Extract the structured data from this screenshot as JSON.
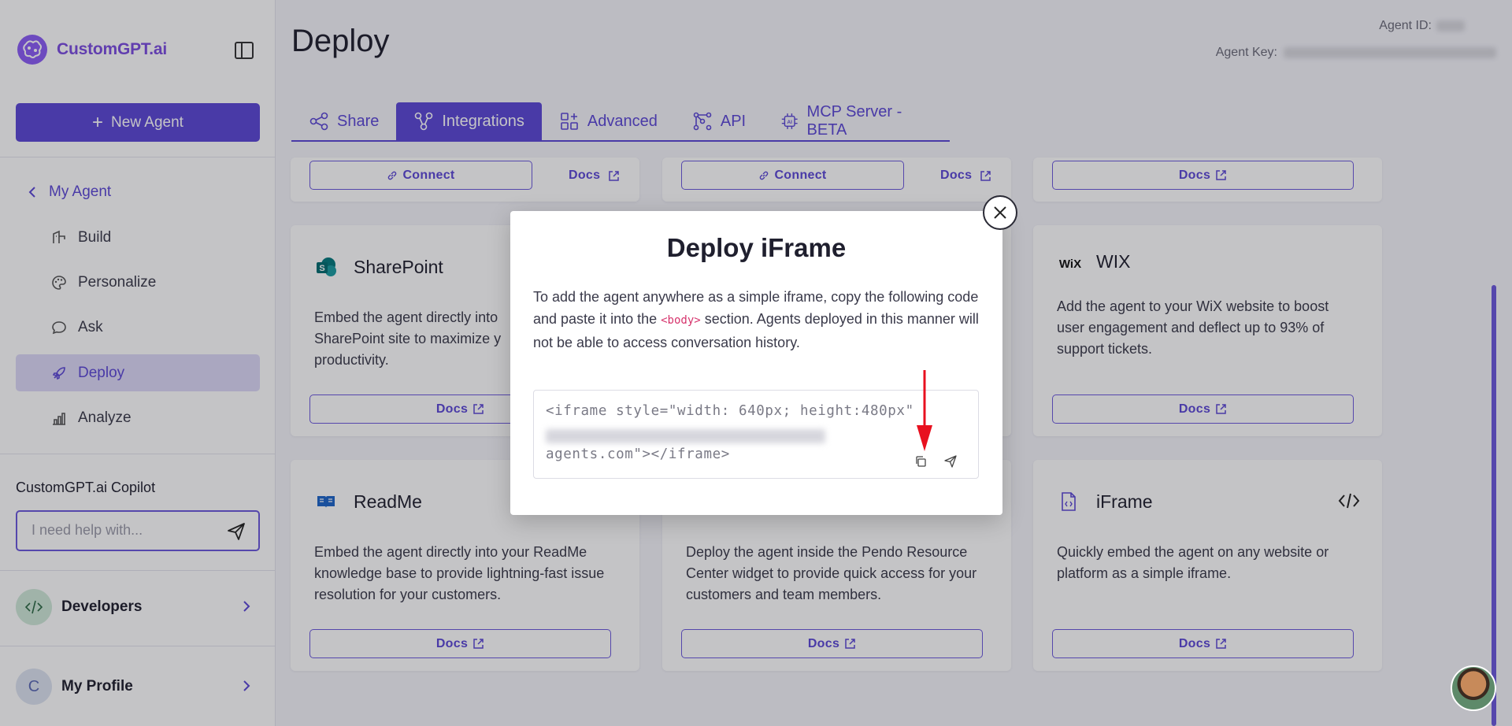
{
  "sidebar": {
    "brand": "CustomGPT.ai",
    "new_agent_label": "New Agent",
    "my_agent_label": "My Agent",
    "nav": [
      {
        "label": "Build",
        "icon": "build-icon"
      },
      {
        "label": "Personalize",
        "icon": "palette-icon"
      },
      {
        "label": "Ask",
        "icon": "chat-bubble-icon"
      },
      {
        "label": "Deploy",
        "icon": "rocket-icon",
        "active": true
      },
      {
        "label": "Analyze",
        "icon": "bar-chart-icon"
      }
    ],
    "copilot_title": "CustomGPT.ai Copilot",
    "copilot_placeholder": "I need help with...",
    "developers_label": "Developers",
    "profile_label": "My Profile",
    "profile_initial": "C"
  },
  "header": {
    "title": "Deploy",
    "agent_id_label": "Agent ID:",
    "agent_key_label": "Agent Key:"
  },
  "tabs": [
    {
      "label": "Share",
      "icon": "share-icon"
    },
    {
      "label": "Integrations",
      "icon": "integrations-icon",
      "active": true
    },
    {
      "label": "Advanced",
      "icon": "grid-plus-icon"
    },
    {
      "label": "API",
      "icon": "api-icon"
    },
    {
      "label": "MCP Server - BETA",
      "icon": "ai-chip-icon"
    }
  ],
  "cards": {
    "top_row": {
      "connect_label": "Connect",
      "docs_label": "Docs"
    },
    "sharepoint": {
      "title": "SharePoint",
      "desc_line1": "Embed the agent directly into",
      "desc_line2": "SharePoint site to maximize y",
      "desc_line3": "productivity.",
      "docs_label": "Docs"
    },
    "wix": {
      "title": "WIX",
      "logo_text": "WiX",
      "desc": "Add the agent to your WiX website to boost user engagement and deflect up to 93% of support tickets.",
      "docs_label": "Docs"
    },
    "readme": {
      "title": "ReadMe",
      "desc": "Embed the agent directly into your ReadMe knowledge base to provide lightning-fast issue resolution for your customers.",
      "docs_label": "Docs"
    },
    "pendo": {
      "desc": "Deploy the agent inside the Pendo Resource Center widget to provide quick access for your customers and team members.",
      "docs_label": "Docs"
    },
    "iframe": {
      "title": "iFrame",
      "desc": "Quickly embed the agent on any website or platform as a simple iframe.",
      "docs_label": "Docs"
    }
  },
  "modal": {
    "title": "Deploy iFrame",
    "desc_before": "To add the agent anywhere as a simple iframe, copy the following code and paste it into the ",
    "desc_code": "<body>",
    "desc_after": " section. Agents deployed in this manner will not be able to access conversation history.",
    "code_line1": "<iframe style=\"width: 640px; height:480px\"",
    "code_line3": "agents.com\"></iframe>"
  },
  "colors": {
    "accent": "#5b47d6",
    "active_nav_bg": "#ddd8f7",
    "arrow": "#e8101f"
  }
}
